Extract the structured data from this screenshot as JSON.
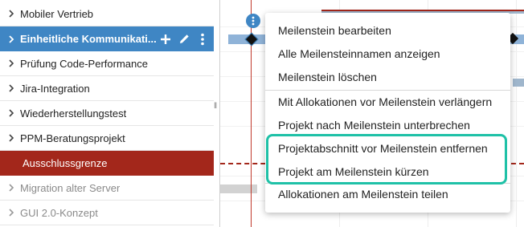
{
  "sidebar": {
    "items": [
      {
        "label": "Mobiler Vertrieb",
        "icon": "chevron-right-icon"
      },
      {
        "label": "Einheitliche Kommunikati...",
        "icon": "chevron-right-icon"
      },
      {
        "label": "Prüfung Code-Performance",
        "icon": "chevron-right-icon"
      },
      {
        "label": "Jira-Integration",
        "icon": "chevron-right-icon"
      },
      {
        "label": "Wiederherstellungstest",
        "icon": "chevron-right-icon"
      },
      {
        "label": "PPM-Beratungsprojekt",
        "icon": "chevron-right-icon"
      },
      {
        "label": "Ausschlussgrenze",
        "icon": ""
      },
      {
        "label": "Migration alter Server",
        "icon": "chevron-right-icon"
      },
      {
        "label": "GUI 2.0-Konzept",
        "icon": "chevron-right-icon"
      }
    ],
    "selected_actions": [
      "plus-icon",
      "pencil-icon",
      "more-vertical-icon"
    ]
  },
  "context_menu": {
    "items": [
      "Meilenstein bearbeiten",
      "Alle Meilensteinnamen anzeigen",
      "Meilenstein löschen",
      "Mit Allokationen vor Meilenstein verlängern",
      "Projekt nach Meilenstein unterbrechen",
      "Projektabschnitt vor Meilenstein entfernen",
      "Projekt am Meilenstein kürzen",
      "Allokationen am Meilenstein teilen"
    ]
  },
  "colors": {
    "selected_row": "#3f86c4",
    "cutoff_row": "#a3271b",
    "highlight": "#1fc1a7",
    "today_line": "#c0392b"
  }
}
